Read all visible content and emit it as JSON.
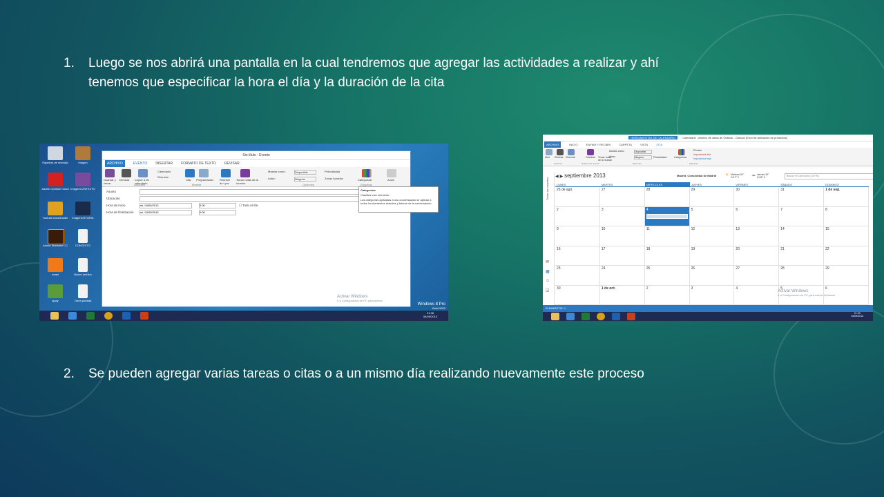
{
  "slide": {
    "item1_number": "1.",
    "item1_line1": "Luego se nos abrirá una pantalla en la cual tendremos que agregar las actividades a realizar y ahí",
    "item1_line2": "tenemos que especificar la hora el día y la duración de la cita",
    "item2_number": "2.",
    "item2_text": "Se pueden agregar varias tareas o citas o a un mismo día realizando nuevamente este proceso"
  },
  "shot1": {
    "window_title": "Sin título - Evento",
    "tabs": [
      "ARCHIVO",
      "EVENTO",
      "INSERTAR",
      "FORMATO DE TEXTO",
      "REVISAR"
    ],
    "ribbon": {
      "save_close": "Guardar y cerrar",
      "delete": "Eliminar",
      "copy_calendar": "Copiar a Mi calendario",
      "calendar": "Calendario",
      "forward": "Reenviar",
      "appointment": "Cita",
      "scheduling": "Programación",
      "lync": "Reunión de Lync",
      "notes": "Tomar notas de la reunión",
      "show_as": "Mostrar como:",
      "available": "Disponible",
      "reminder": "Aviso:",
      "none": "Ninguno",
      "recurrence": "Periodicidad",
      "timezones": "Zonas horarias",
      "categorize": "Categorizar",
      "zoom": "Zoom",
      "group_actions": "Acciones",
      "group_show": "Mostrar",
      "group_options": "Opciones",
      "group_tags": "Etiquetas"
    },
    "form": {
      "subject": "Asunto",
      "location": "Ubicación",
      "start": "Hora de inicio",
      "end": "Hora de finalización",
      "start_date": "mi. 04/09/2013",
      "end_date": "mi. 04/09/2013",
      "start_time": "0:00",
      "end_time": "0:00",
      "all_day": "Todo el día"
    },
    "tooltip": {
      "title": "Categorizar",
      "line1": "Clasifica este elemento.",
      "line2": "Las categorías aplicadas a una conversación se aplican a todos los elementos actuales y futuros de la conversación."
    },
    "desktop_icons": [
      "Papelera de reciclaje",
      "Imagen",
      "Adobe Creative Cloud",
      "imagenCONTEXTO",
      "Youtube Downloader",
      "imagenOSTORIA",
      "Adobe Illustrator CC",
      "CONTEXTO",
      "avast",
      "Nuevo archivo",
      "splay",
      "Tarea portada"
    ],
    "watermark1": "Activar Windows",
    "watermark2": "Ir a Configuración de PC para activar",
    "os_label": "Windows 8 Pro",
    "build": "Build 9200",
    "clock_time": "21:38",
    "clock_date": "04/09/2013"
  },
  "shot2": {
    "window_title": "Calendario - Archivo de datos de Outlook - Outlook (Error de activación de productos)",
    "context_tab": "HERRAMIENTAS DE CALENDARIO",
    "tabs": [
      "ARCHIVO",
      "INICIO",
      "ENVIAR Y RECIBIR",
      "CARPETA",
      "VISTA",
      "CITA"
    ],
    "ribbon": {
      "open": "Abrir",
      "delete": "Eliminar",
      "forward": "Reenviar",
      "onenote": "OneNote",
      "notes": "Tomar notas de la reunión",
      "show_as": "Mostrar como:",
      "available": "Disponible",
      "reminder": "Aviso:",
      "none": "Ninguno",
      "recurrence": "Periodicidad",
      "categorize": "Categorizar",
      "private": "Privado",
      "high": "Importancia alta",
      "low": "Importancia baja",
      "group_actions": "Acciones",
      "group_notes": "Notas de la reunión",
      "group_options": "Opciones",
      "group_tags": "Etiquetas"
    },
    "month_title": "septiembre 2013",
    "location": "Madrid, Comunidad de Madrid",
    "weather_today": "Mañana 30° C/17° C",
    "weather_tomorrow": "viernes 30° C/18° C",
    "search_placeholder": "Buscar en Calendario (Ctrl+B)",
    "side_label": "Todas las carpetas",
    "weekdays": [
      "LUNES",
      "MARTES",
      "MIÉRCOLES",
      "JUEVES",
      "VIERNES",
      "SÁBADO",
      "DOMINGO"
    ],
    "weeks": [
      [
        "26 de agó.",
        "27",
        "28",
        "29",
        "30",
        "31",
        "1 de sep."
      ],
      [
        "2",
        "3",
        "4",
        "5",
        "6",
        "7",
        "8"
      ],
      [
        "9",
        "10",
        "11",
        "12",
        "13",
        "14",
        "15"
      ],
      [
        "16",
        "17",
        "18",
        "19",
        "20",
        "21",
        "22"
      ],
      [
        "23",
        "24",
        "25",
        "26",
        "27",
        "28",
        "29"
      ],
      [
        "30",
        "1 de oct.",
        "2",
        "3",
        "4",
        "5",
        "6"
      ]
    ],
    "status_items": "ELEMENTOS: 1",
    "watermark1": "Activar Windows",
    "watermark2": "Ir a Configuración de PC para activar Windows",
    "clock_time": "21:39",
    "clock_date": "04/09/2013"
  }
}
